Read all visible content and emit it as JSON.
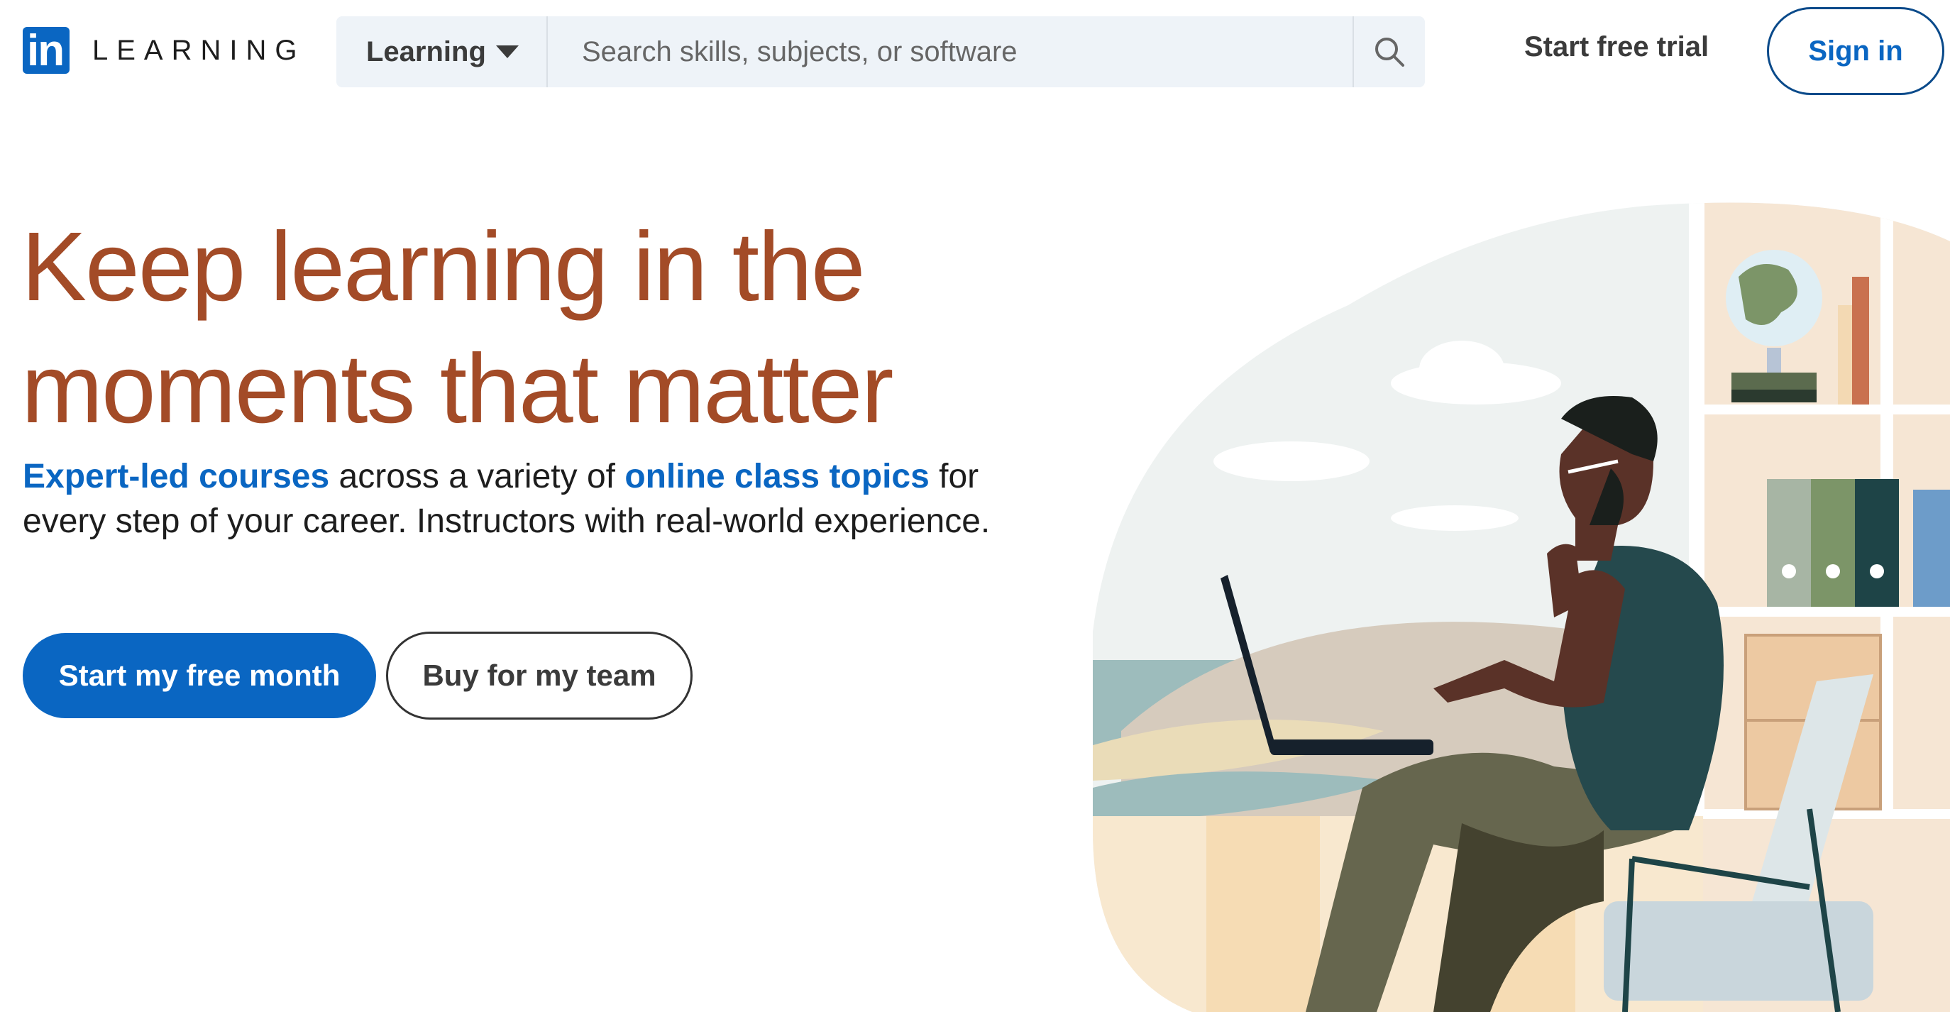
{
  "header": {
    "logo_mark": "in",
    "logo_text": "LEARNING",
    "search": {
      "category": "Learning",
      "placeholder": "Search skills, subjects, or software"
    },
    "start_trial": "Start free trial",
    "sign_in": "Sign in"
  },
  "hero": {
    "headline_line1": "Keep learning in the",
    "headline_line2": "moments that matter",
    "sub_link1": "Expert-led courses",
    "sub_text1": " across a variety of ",
    "sub_link2": "online class topics",
    "sub_text2": " for every step of your career. Instructors with real-world experience.",
    "cta_primary": "Start my free month",
    "cta_secondary": "Buy for my team"
  },
  "colors": {
    "brand_blue": "#0a66c2",
    "headline_rust": "#a34b27",
    "search_bg": "#eef3f8"
  },
  "icons": [
    "linkedin-logo-icon",
    "chevron-down-icon",
    "search-icon"
  ]
}
